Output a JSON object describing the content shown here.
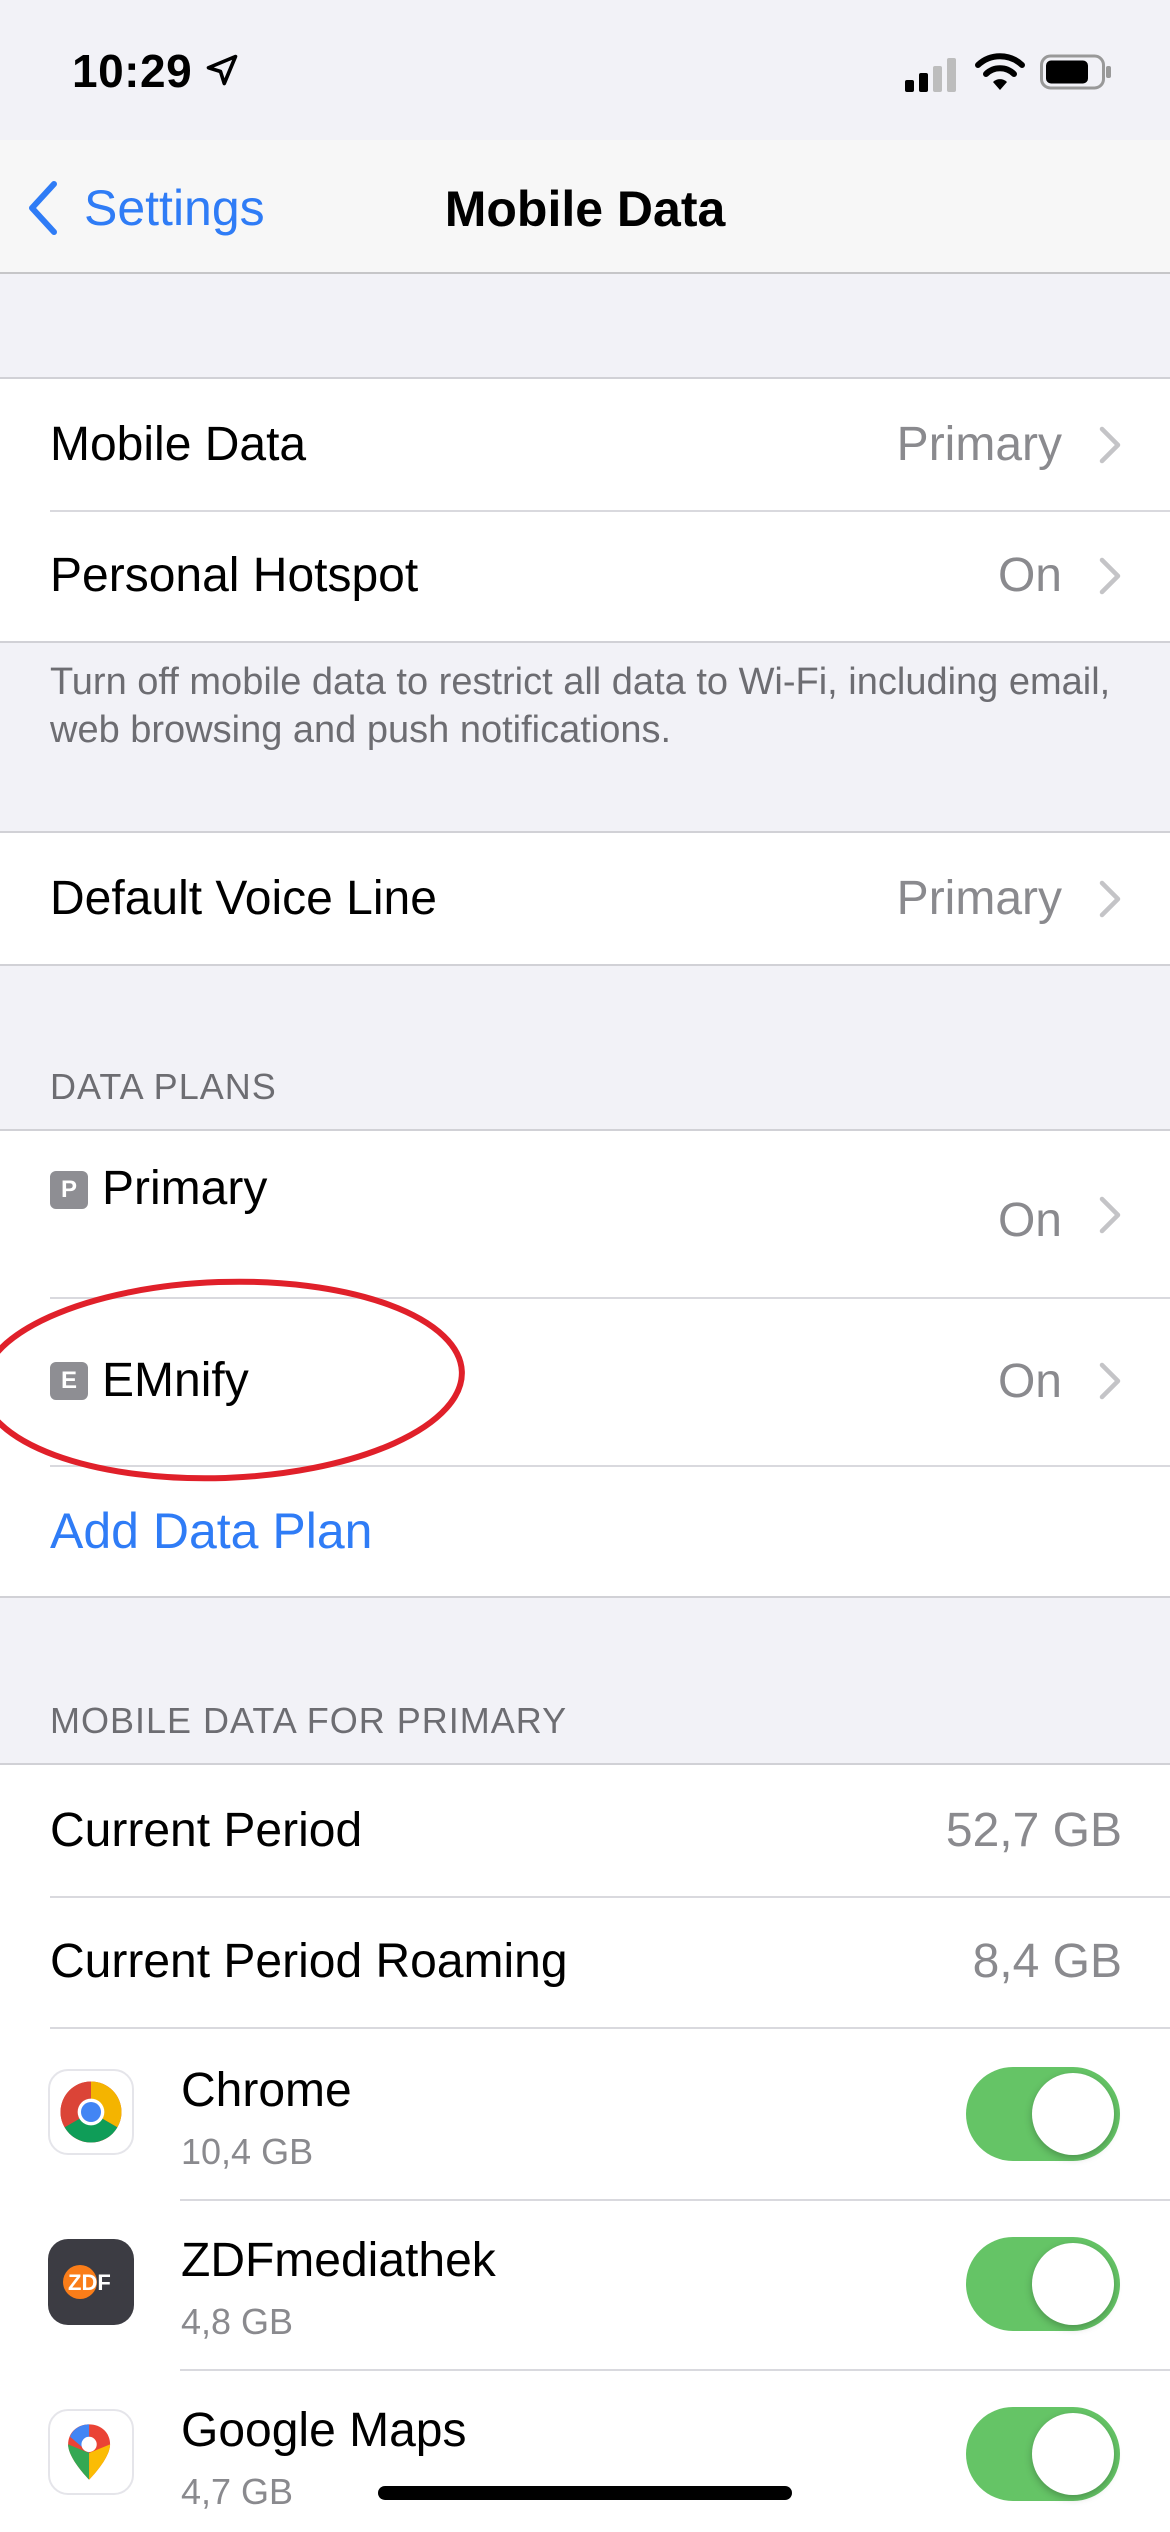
{
  "status_bar": {
    "time": "10:29"
  },
  "nav": {
    "back_label": "Settings",
    "title": "Mobile Data"
  },
  "group1": {
    "rows": [
      {
        "label": "Mobile Data",
        "value": "Primary"
      },
      {
        "label": "Personal Hotspot",
        "value": "On"
      }
    ],
    "footer": "Turn off mobile data to restrict all data to Wi-Fi, including email, web browsing and push notifications."
  },
  "group2": {
    "rows": [
      {
        "label": "Default Voice Line",
        "value": "Primary"
      }
    ]
  },
  "data_plans": {
    "header": "DATA PLANS",
    "plans": [
      {
        "badge": "P",
        "label": "Primary",
        "value": "On"
      },
      {
        "badge": "E",
        "label": "EMnify",
        "value": "On"
      }
    ],
    "add_label": "Add Data Plan"
  },
  "mobile_data_for": {
    "header": "MOBILE DATA FOR PRIMARY",
    "rows": [
      {
        "label": "Current Period",
        "value": "52,7 GB"
      },
      {
        "label": "Current Period Roaming",
        "value": "8,4 GB"
      }
    ],
    "apps": [
      {
        "name": "Chrome",
        "size": "10,4 GB",
        "enabled": true,
        "icon": "chrome-icon"
      },
      {
        "name": "ZDFmediathek",
        "size": "4,8 GB",
        "enabled": true,
        "icon": "zdf-icon",
        "icon_text": "ZDF"
      },
      {
        "name": "Google Maps",
        "size": "4,7 GB",
        "enabled": true,
        "icon": "google-maps-icon"
      }
    ]
  },
  "annotation": {
    "color": "#e0202a"
  },
  "colors": {
    "accent": "#2f7cf6",
    "toggle_on": "#65c466"
  }
}
